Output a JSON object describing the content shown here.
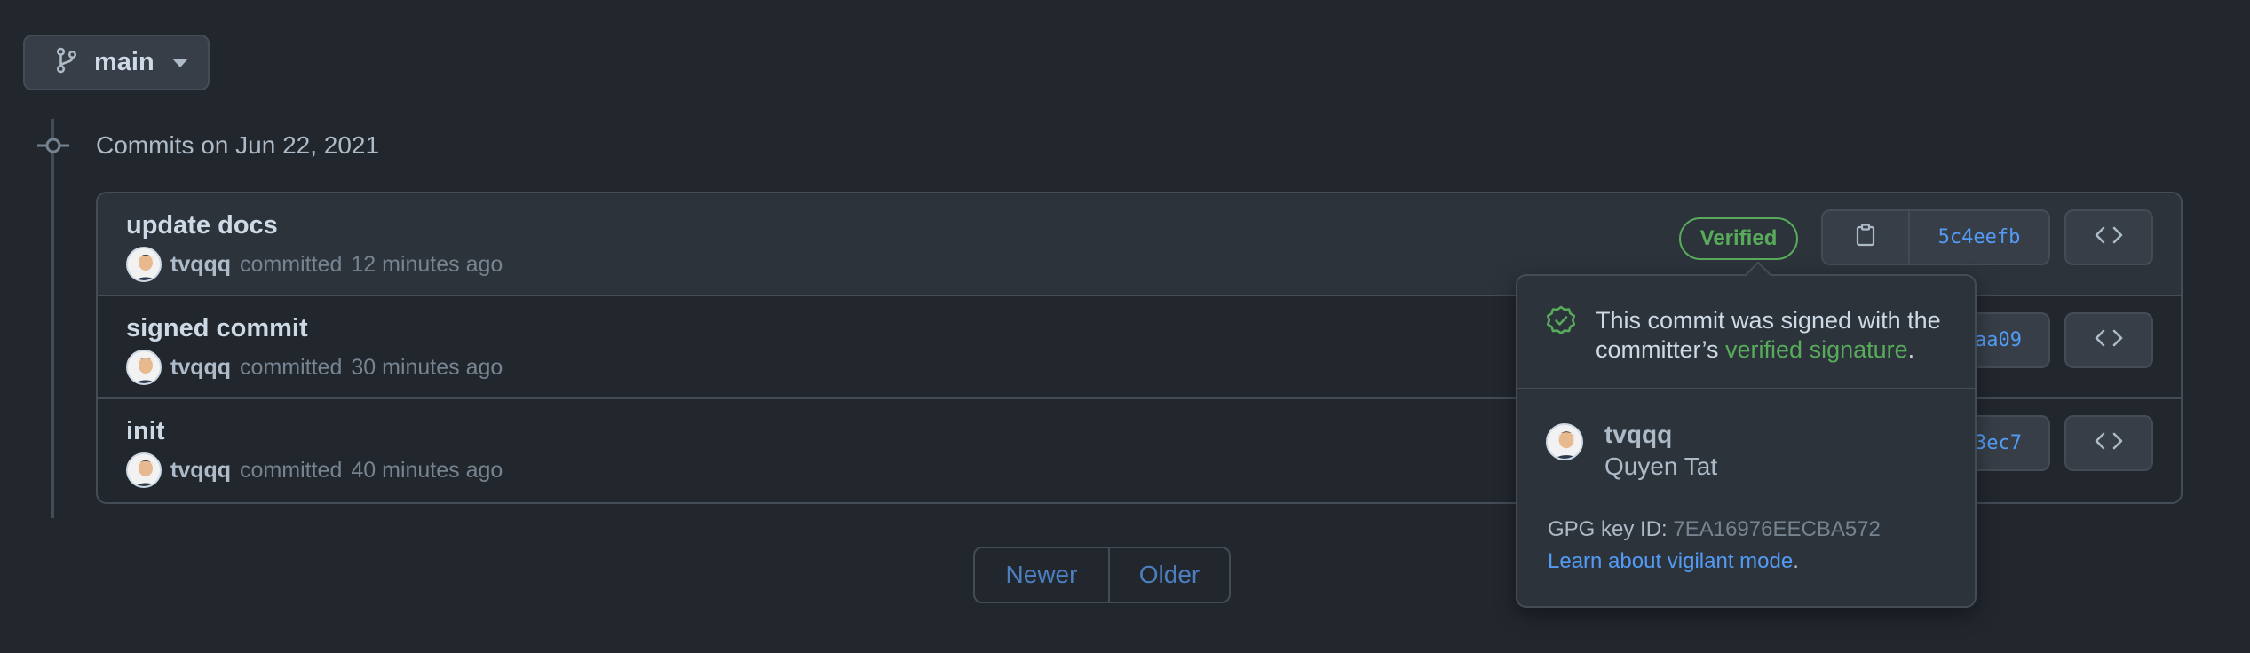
{
  "branch": {
    "label": "main"
  },
  "timeline": {
    "heading": "Commits on Jun 22, 2021"
  },
  "commits": [
    {
      "message": "update docs",
      "author": "tvqqq",
      "action": "committed",
      "time": "12 minutes ago",
      "badge": "Verified",
      "sha": "5c4eefb"
    },
    {
      "message": "signed commit",
      "author": "tvqqq",
      "action": "committed",
      "time": "30 minutes ago",
      "sha": "aa09"
    },
    {
      "message": "init",
      "author": "tvqqq",
      "action": "committed",
      "time": "40 minutes ago",
      "sha": "3ec7"
    }
  ],
  "pagination": {
    "newer": "Newer",
    "older": "Older"
  },
  "popover": {
    "text_before": "This commit was signed with the committer’s ",
    "text_link": "verified signature",
    "text_after": ".",
    "username": "tvqqq",
    "fullname": "Quyen Tat",
    "gpg_label": "GPG key ID: ",
    "gpg_id": "7EA16976EECBA572",
    "learn_link": "Learn about vigilant mode",
    "learn_after": "."
  },
  "colors": {
    "background": "#22272e",
    "verified": "#57ab5a",
    "link": "#539bf5"
  }
}
